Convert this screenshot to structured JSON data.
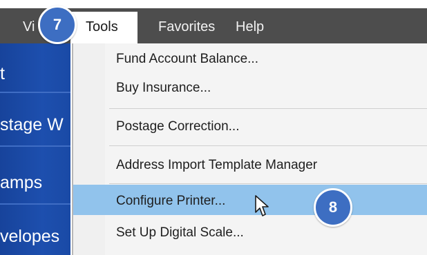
{
  "menubar": {
    "view_label": "Vi",
    "tools_label": "Tools",
    "favorites_label": "Favorites",
    "help_label": "Help"
  },
  "sidebar": {
    "items": [
      {
        "label": "t"
      },
      {
        "label": "stage W"
      },
      {
        "label": "amps"
      },
      {
        "label": "velopes"
      }
    ]
  },
  "dropdown": {
    "items": [
      {
        "label": "Fund Account Balance..."
      },
      {
        "label": "Buy Insurance..."
      },
      {
        "label": "Postage Correction..."
      },
      {
        "label": "Address Import Template Manager"
      },
      {
        "label": "Configure Printer..."
      },
      {
        "label": "Set Up Digital Scale..."
      }
    ],
    "highlighted_index": 4
  },
  "callouts": {
    "step7": "7",
    "step8": "8"
  },
  "colors": {
    "menubar_bg": "#4d4d4d",
    "sidebar_bg": "#1d4fae",
    "highlight": "#91c3ec",
    "callout_bg": "#3d6ec2"
  },
  "icons": {
    "cursor": "mouse-pointer-icon"
  }
}
